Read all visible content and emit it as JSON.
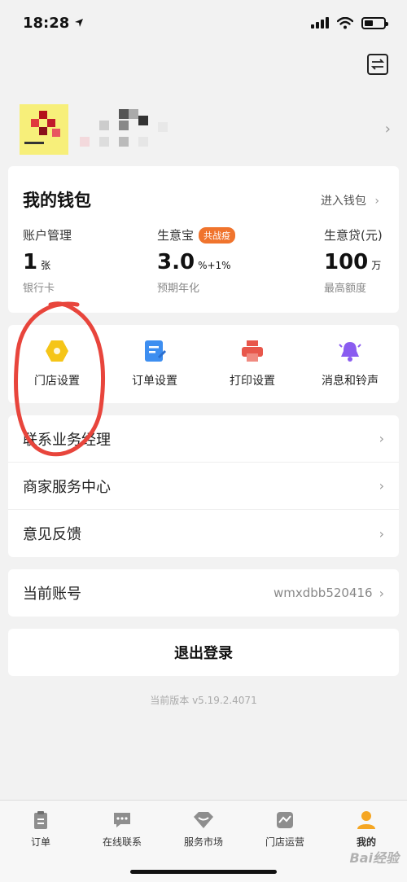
{
  "status_bar": {
    "time": "18:28",
    "battery_level": 0.45
  },
  "wallet": {
    "title": "我的钱包",
    "enter_label": "进入钱包",
    "columns": [
      {
        "label": "账户管理",
        "value": "1",
        "unit": "张",
        "sub": "银行卡"
      },
      {
        "label": "生意宝",
        "badge": "共战疫",
        "value": "3.0",
        "unit": "%+1%",
        "sub": "预期年化"
      },
      {
        "label": "生意贷(元)",
        "value": "100",
        "unit": "万",
        "sub": "最高额度"
      }
    ]
  },
  "shortcuts": [
    {
      "label": "门店设置",
      "icon": "store-settings-icon",
      "color": "#f5c518"
    },
    {
      "label": "订单设置",
      "icon": "order-settings-icon",
      "color": "#3d8ef0"
    },
    {
      "label": "打印设置",
      "icon": "printer-icon",
      "color": "#e8574b"
    },
    {
      "label": "消息和铃声",
      "icon": "bell-icon",
      "color": "#8a5cf0"
    }
  ],
  "menu": [
    {
      "label": "联系业务经理"
    },
    {
      "label": "商家服务中心"
    },
    {
      "label": "意见反馈"
    }
  ],
  "account": {
    "label": "当前账号",
    "value": "wmxdbb520416"
  },
  "logout_label": "退出登录",
  "version": "当前版本 v5.19.2.4071",
  "tabs": [
    {
      "label": "订单",
      "icon": "clipboard-icon",
      "active": false
    },
    {
      "label": "在线联系",
      "icon": "chat-icon",
      "active": false
    },
    {
      "label": "服务市场",
      "icon": "market-icon",
      "active": false
    },
    {
      "label": "门店运营",
      "icon": "chart-icon",
      "active": false
    },
    {
      "label": "我的",
      "icon": "person-icon",
      "active": true
    }
  ],
  "watermark": "Bai经验",
  "colors": {
    "accent": "#f5c518",
    "badge": "#f0742d",
    "annotation": "#e8453c"
  }
}
